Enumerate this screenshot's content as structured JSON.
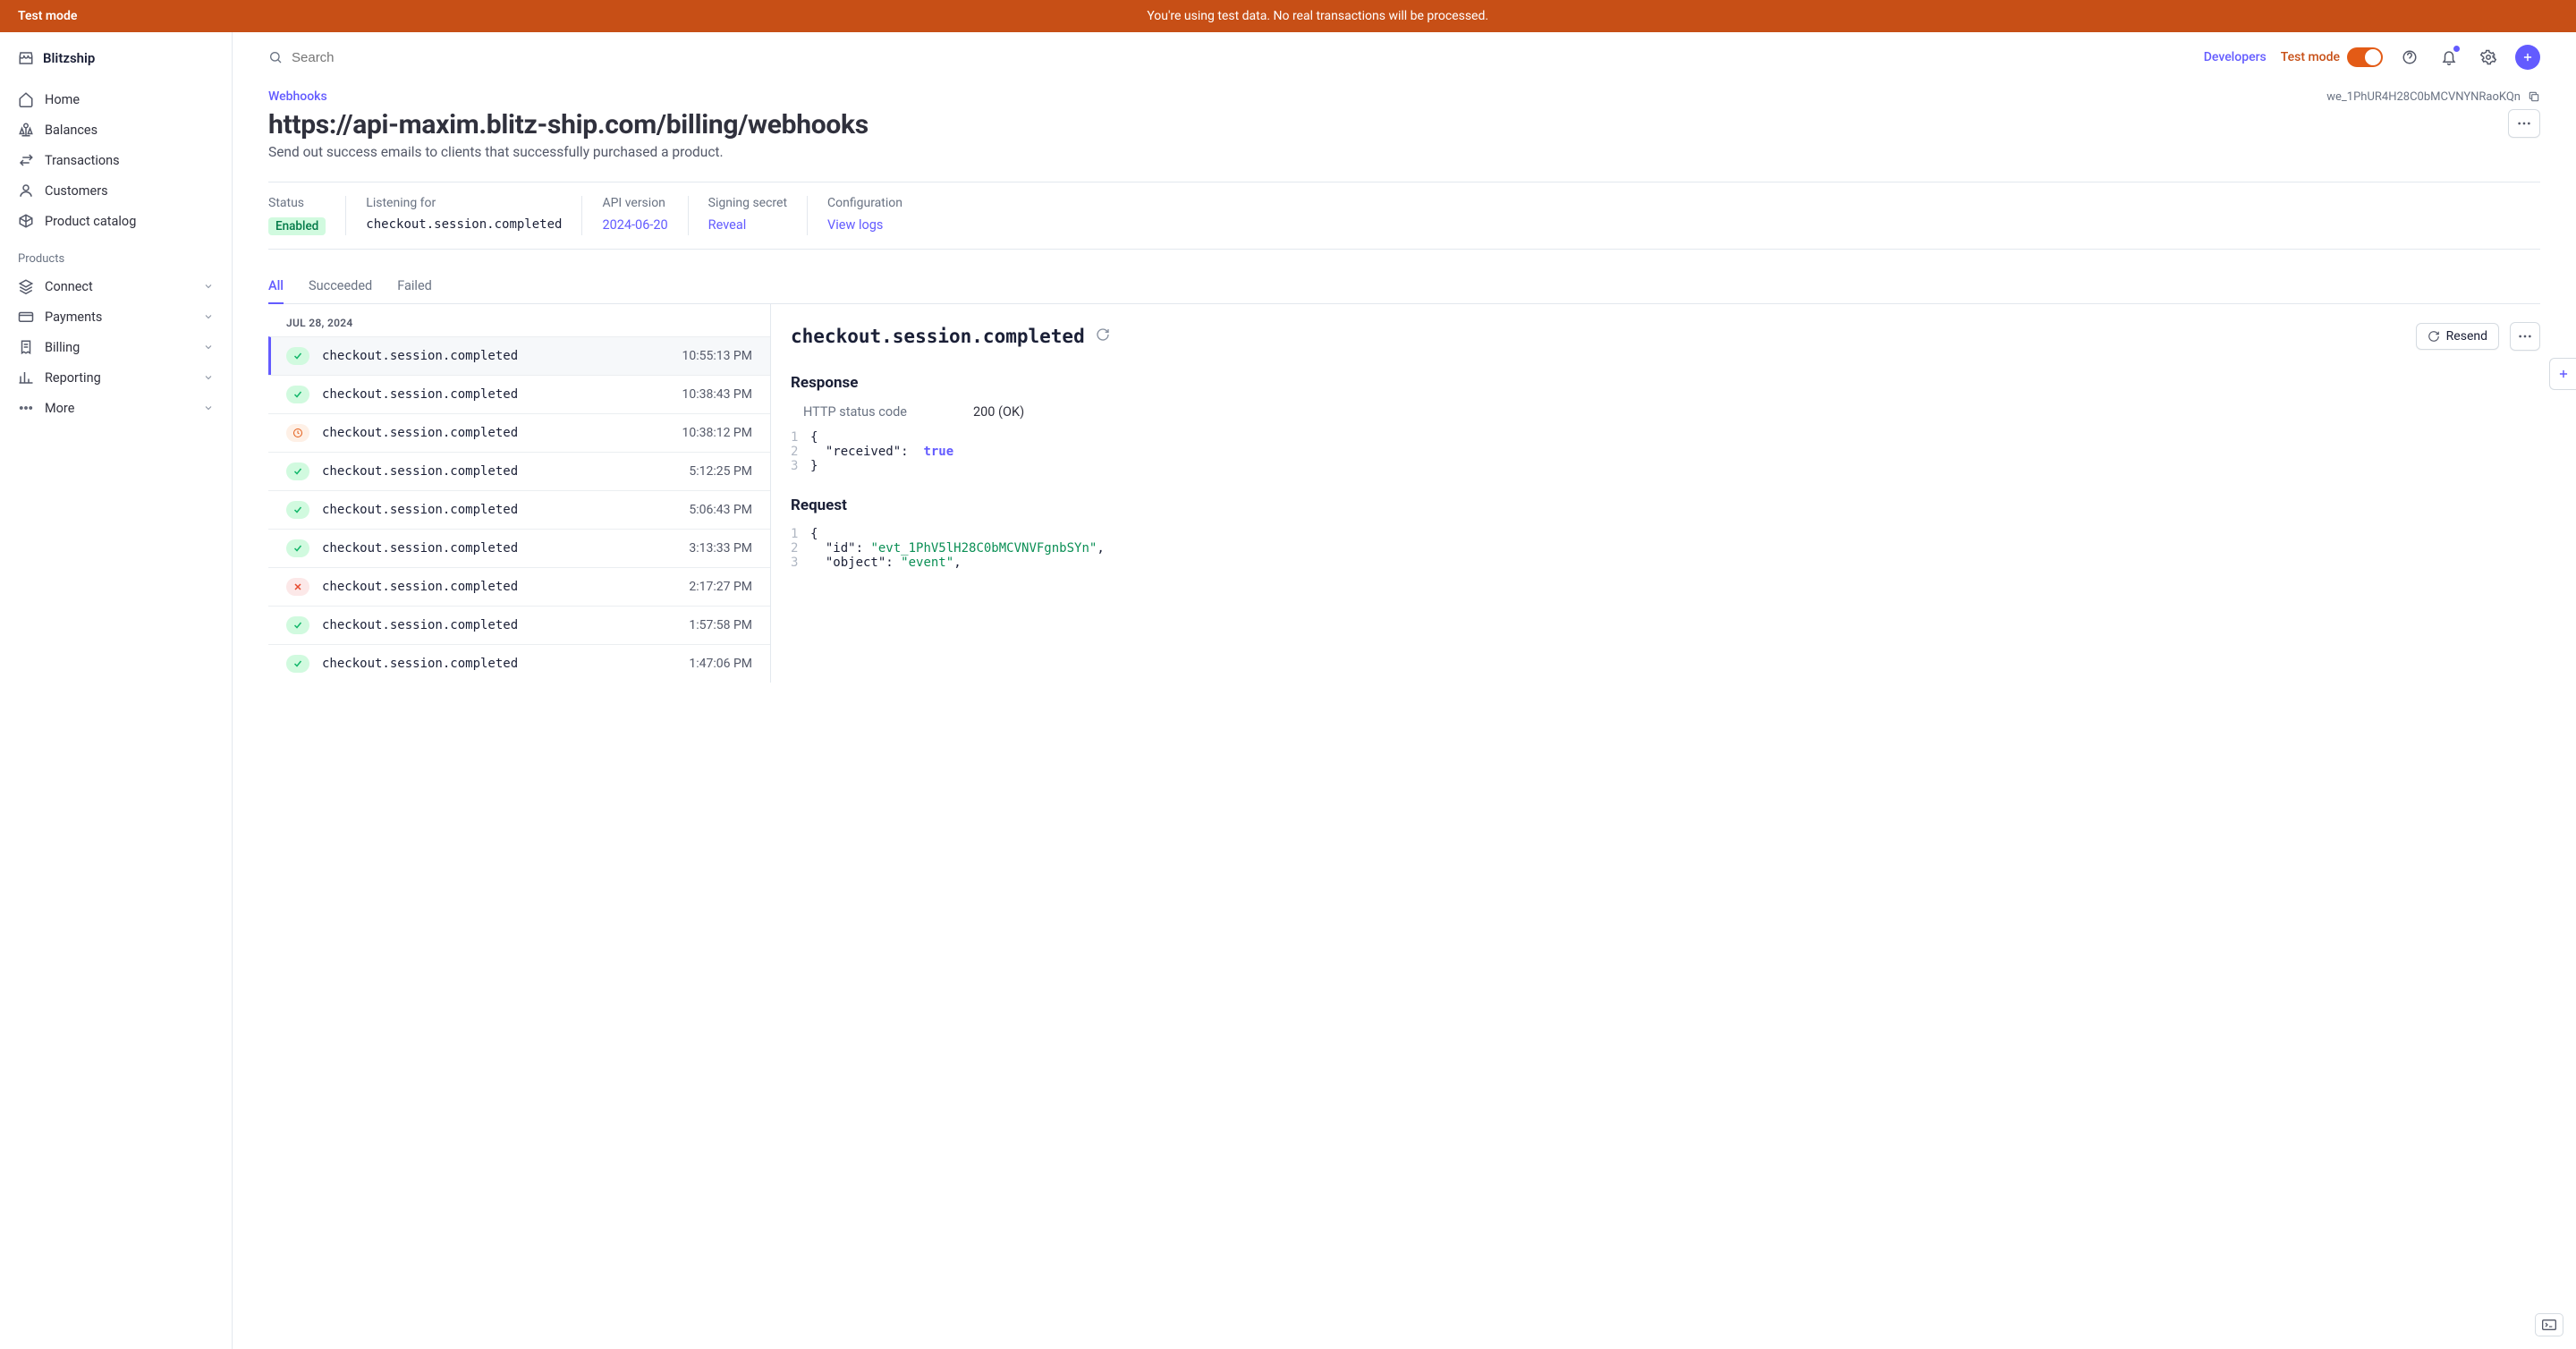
{
  "banner": {
    "label": "Test mode",
    "message": "You're using test data. No real transactions will be processed."
  },
  "brand": "Blitzship",
  "nav": {
    "main": [
      {
        "label": "Home"
      },
      {
        "label": "Balances"
      },
      {
        "label": "Transactions"
      },
      {
        "label": "Customers"
      },
      {
        "label": "Product catalog"
      }
    ],
    "products_label": "Products",
    "products": [
      {
        "label": "Connect"
      },
      {
        "label": "Payments"
      },
      {
        "label": "Billing"
      },
      {
        "label": "Reporting"
      },
      {
        "label": "More"
      }
    ]
  },
  "topbar": {
    "search_placeholder": "Search",
    "developers": "Developers",
    "testmode": "Test mode"
  },
  "breadcrumb": "Webhooks",
  "endpoint_id": "we_1PhUR4H28C0bMCVNYNRaoKQn",
  "page_title": "https://api-maxim.blitz-ship.com/billing/webhooks",
  "page_desc": "Send out success emails to clients that successfully purchased a product.",
  "stats": {
    "status_label": "Status",
    "status_value": "Enabled",
    "listening_label": "Listening for",
    "listening_value": "checkout.session.completed",
    "api_label": "API version",
    "api_value": "2024-06-20",
    "secret_label": "Signing secret",
    "secret_value": "Reveal",
    "config_label": "Configuration",
    "config_value": "View logs"
  },
  "tabs": [
    "All",
    "Succeeded",
    "Failed"
  ],
  "events": {
    "date": "JUL 28, 2024",
    "rows": [
      {
        "status": "ok",
        "type": "checkout.session.completed",
        "time": "10:55:13 PM",
        "selected": true
      },
      {
        "status": "ok",
        "type": "checkout.session.completed",
        "time": "10:38:43 PM"
      },
      {
        "status": "warn",
        "type": "checkout.session.completed",
        "time": "10:38:12 PM"
      },
      {
        "status": "ok",
        "type": "checkout.session.completed",
        "time": "5:12:25 PM"
      },
      {
        "status": "ok",
        "type": "checkout.session.completed",
        "time": "5:06:43 PM"
      },
      {
        "status": "ok",
        "type": "checkout.session.completed",
        "time": "3:13:33 PM"
      },
      {
        "status": "err",
        "type": "checkout.session.completed",
        "time": "2:17:27 PM"
      },
      {
        "status": "ok",
        "type": "checkout.session.completed",
        "time": "1:57:58 PM"
      },
      {
        "status": "ok",
        "type": "checkout.session.completed",
        "time": "1:47:06 PM"
      }
    ]
  },
  "detail": {
    "title": "checkout.session.completed",
    "resend": "Resend",
    "response_label": "Response",
    "http_label": "HTTP status code",
    "http_value": "200 (OK)",
    "request_label": "Request",
    "request_id": "evt_1PhV5lH28C0bMCVNVFgnbSYn",
    "request_object": "event"
  }
}
